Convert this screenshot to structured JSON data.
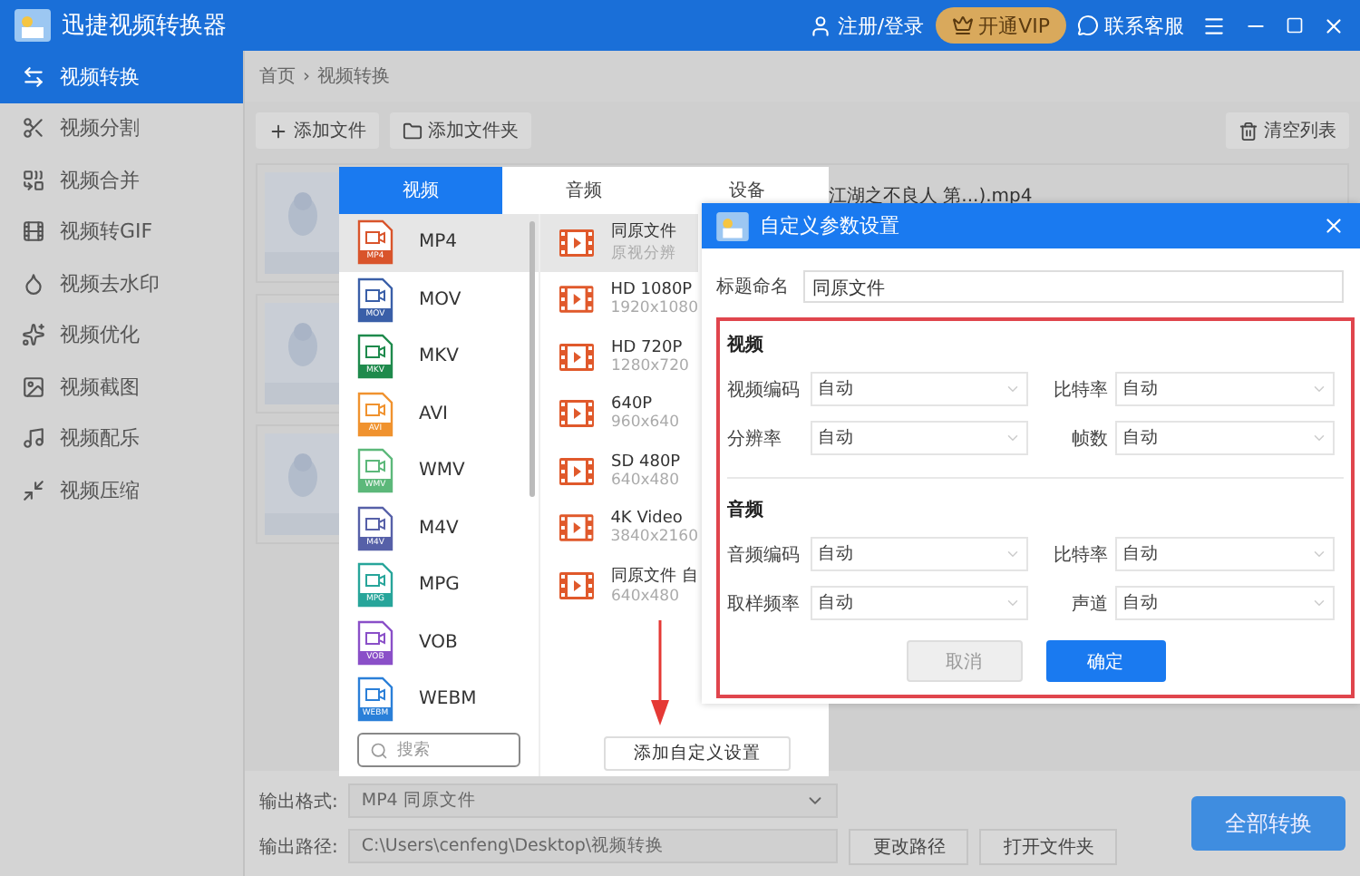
{
  "app": {
    "title": "迅捷视频转换器",
    "login": "注册/登录",
    "vip": "开通VIP",
    "support": "联系客服"
  },
  "sidebar": {
    "items": [
      {
        "label": "视频转换",
        "selected": true
      },
      {
        "label": "视频分割",
        "selected": false
      },
      {
        "label": "视频合并",
        "selected": false
      },
      {
        "label": "视频转GIF",
        "selected": false
      },
      {
        "label": "视频去水印",
        "selected": false
      },
      {
        "label": "视频优化",
        "selected": false
      },
      {
        "label": "视频截图",
        "selected": false
      },
      {
        "label": "视频配乐",
        "selected": false
      },
      {
        "label": "视频压缩",
        "selected": false
      }
    ]
  },
  "breadcrumb": [
    "首页",
    "视频转换"
  ],
  "breadcrumb_separator": "›",
  "toolbar": {
    "add_file": "添加文件",
    "add_folder": "添加文件夹",
    "clear": "清空列表"
  },
  "files": [
    {
      "kind": "picture",
      "name": "江湖之不良人 第...).mp4"
    },
    {
      "kind": "picture"
    },
    {
      "kind": "picture"
    }
  ],
  "format_popup": {
    "tabs": [
      {
        "label": "视频",
        "selected": true
      },
      {
        "label": "音频",
        "selected": false
      },
      {
        "label": "设备",
        "selected": false
      }
    ],
    "formats": [
      {
        "name": "MP4",
        "badge": "MP4",
        "color": "#d9542b",
        "selected": true
      },
      {
        "name": "MOV",
        "badge": "MOV",
        "color": "#3a5fa8",
        "selected": false
      },
      {
        "name": "MKV",
        "badge": "MKV",
        "color": "#1e8a4c",
        "selected": false
      },
      {
        "name": "AVI",
        "badge": "AVI",
        "color": "#f0922e",
        "selected": false
      },
      {
        "name": "WMV",
        "badge": "WMV",
        "color": "#5cb87a",
        "selected": false
      },
      {
        "name": "M4V",
        "badge": "M4V",
        "color": "#5660a8",
        "selected": false
      },
      {
        "name": "MPG",
        "badge": "MPG",
        "color": "#27a59a",
        "selected": false
      },
      {
        "name": "VOB",
        "badge": "VOB",
        "color": "#8a4fc8",
        "selected": false
      },
      {
        "name": "WEBM",
        "badge": "WEBM",
        "color": "#2a7fd8",
        "selected": false
      }
    ],
    "presets": [
      {
        "name": "同原文件",
        "detail": "原视分辨",
        "selected": true
      },
      {
        "name": "HD 1080P",
        "detail": "1920x1080",
        "selected": false
      },
      {
        "name": "HD 720P",
        "detail": "1280x720",
        "selected": false
      },
      {
        "name": "640P",
        "detail": "960x640",
        "selected": false
      },
      {
        "name": "SD 480P",
        "detail": "640x480",
        "selected": false
      },
      {
        "name": "4K Video",
        "detail": "3840x2160",
        "selected": false
      },
      {
        "name": "同原文件 自",
        "detail": "640x480",
        "selected": false
      }
    ],
    "search": {
      "placeholder": "搜索"
    },
    "add_custom": "添加自定义设置"
  },
  "dialog": {
    "title": "自定义参数设置",
    "name_label": "标题命名",
    "name_value": "同原文件",
    "sections": [
      {
        "title": "视频",
        "fields": [
          {
            "label": "视频编码",
            "value": "自动"
          },
          {
            "label": "比特率",
            "value": "自动"
          },
          {
            "label": "分辨率",
            "value": "自动"
          },
          {
            "label": "帧数",
            "value": "自动"
          }
        ]
      },
      {
        "title": "音频",
        "fields": [
          {
            "label": "音频编码",
            "value": "自动"
          },
          {
            "label": "比特率",
            "value": "自动"
          },
          {
            "label": "取样频率",
            "value": "自动"
          },
          {
            "label": "声道",
            "value": "自动"
          }
        ]
      }
    ],
    "cancel": "取消",
    "ok": "确定"
  },
  "output": {
    "format_label": "输出格式:",
    "format_value": "MP4  同原文件",
    "path_label": "输出路径:",
    "path_value": "C:\\Users\\cenfeng\\Desktop\\视频转换",
    "change_path": "更改路径",
    "open_folder": "打开文件夹",
    "convert_all": "全部转换"
  }
}
